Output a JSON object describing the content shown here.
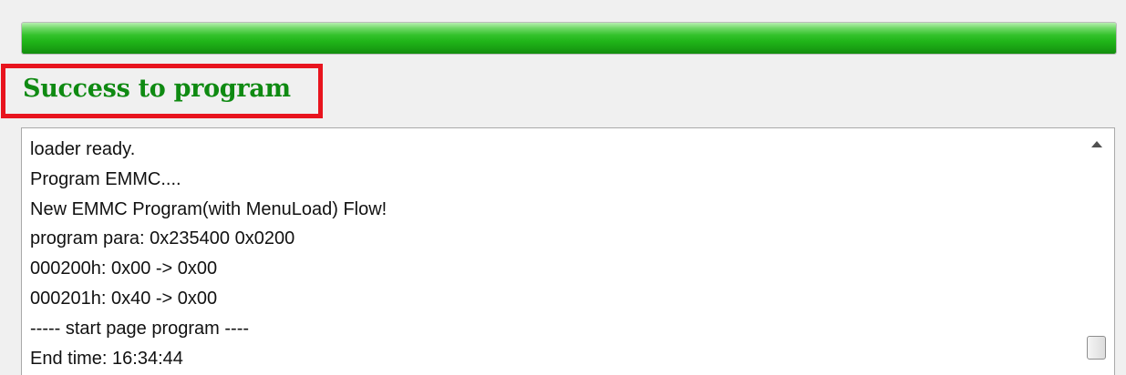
{
  "progress": {
    "value_percent": 100,
    "color": "#22b81a"
  },
  "status": {
    "text": "Success to program",
    "color": "#0f8a12",
    "highlight_color": "#e8141e"
  },
  "log": {
    "lines": [
      "loader ready.",
      "Program EMMC....",
      "New EMMC Program(with MenuLoad) Flow!",
      "program para: 0x235400 0x0200",
      "000200h: 0x00 -> 0x00",
      "000201h: 0x40 -> 0x00",
      "----- start page program ----",
      "End time: 16:34:44"
    ]
  },
  "scrollbar": {
    "up_icon": "triangle-up"
  }
}
